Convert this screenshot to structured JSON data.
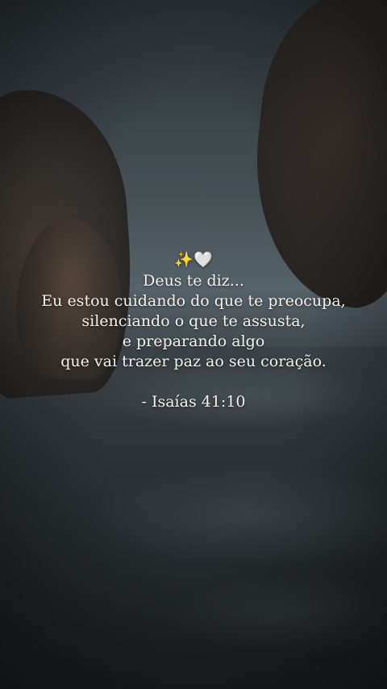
{
  "quote": {
    "emoji": "✨🤍",
    "lines": [
      "Deus te diz...",
      "Eu estou cuidando do que te preocupa,",
      "silenciando o que te assusta,",
      "e preparando algo",
      "que vai trazer paz ao seu coração."
    ],
    "reference": "- Isaías 41:10"
  }
}
